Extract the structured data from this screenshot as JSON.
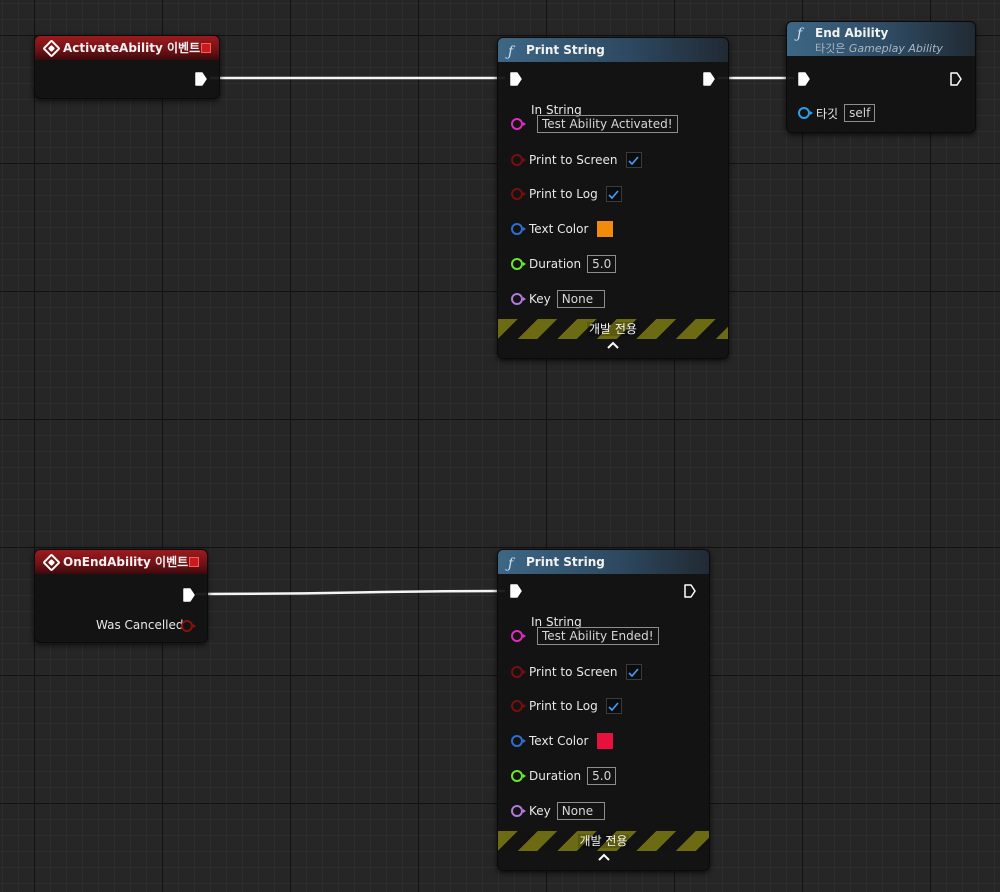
{
  "colors": {
    "exec": "#ffffff",
    "string_pin": "#e02bc0",
    "bool_pin": "#8a1010",
    "color_pin": "#2f6fd0",
    "float_pin": "#6ae82e",
    "name_pin": "#b07ad8",
    "object_pin": "#2aa0e8",
    "text_color_orange": "#f28a0c",
    "text_color_red": "#e8103c",
    "check_color": "#3aa0ff"
  },
  "event_activate": {
    "title": "ActivateAbility 이벤트"
  },
  "print_string_1": {
    "title": "Print String",
    "in_string_label": "In String",
    "in_string_value": "Test Ability Activated!",
    "print_to_screen_label": "Print to Screen",
    "print_to_log_label": "Print to Log",
    "text_color_label": "Text Color",
    "duration_label": "Duration",
    "duration_value": "5.0",
    "key_label": "Key",
    "key_value": "None",
    "dev_only": "개발 전용",
    "collapse": "⌃"
  },
  "end_ability": {
    "title": "End Ability",
    "subtitle_prefix": "타깃은",
    "subtitle_target": "Gameplay Ability",
    "target_label": "타깃",
    "target_value": "self"
  },
  "event_end": {
    "title": "OnEndAbility 이벤트",
    "was_cancelled_label": "Was Cancelled"
  },
  "print_string_2": {
    "title": "Print String",
    "in_string_label": "In String",
    "in_string_value": "Test Ability Ended!",
    "print_to_screen_label": "Print to Screen",
    "print_to_log_label": "Print to Log",
    "text_color_label": "Text Color",
    "duration_label": "Duration",
    "duration_value": "5.0",
    "key_label": "Key",
    "key_value": "None",
    "dev_only": "개발 전용",
    "collapse": "⌃"
  }
}
